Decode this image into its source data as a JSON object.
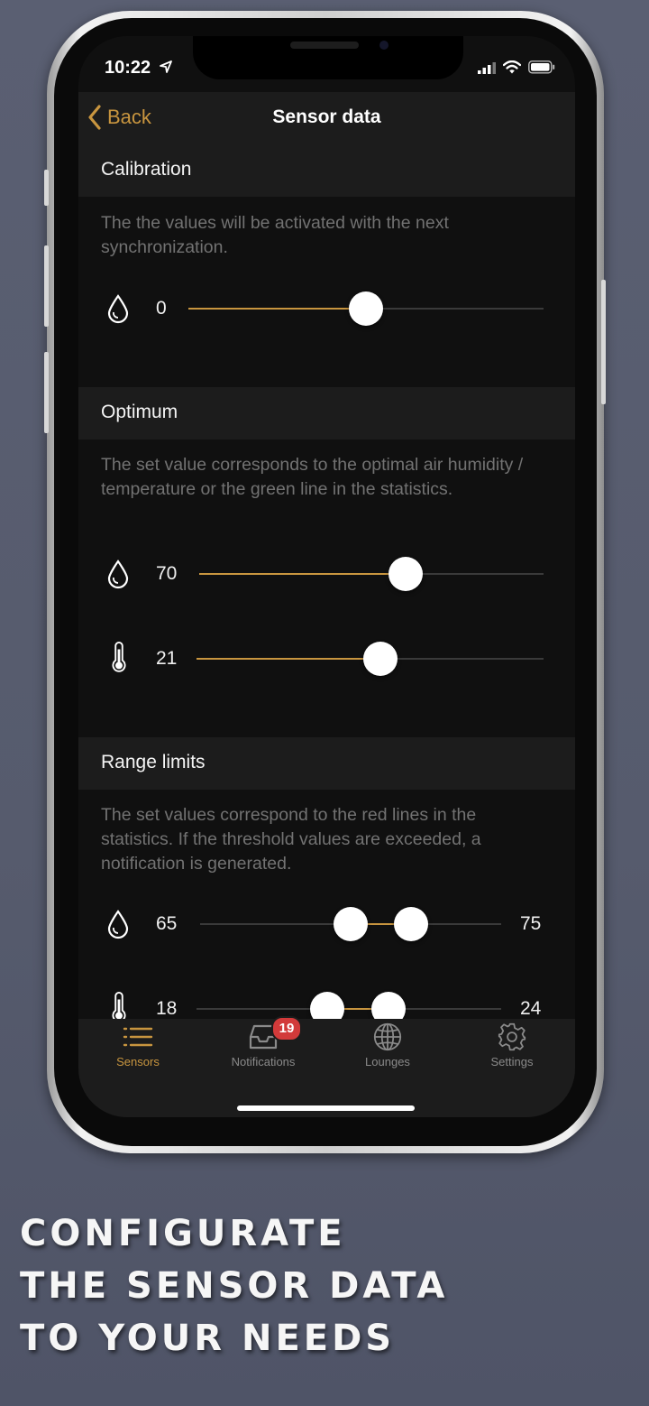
{
  "status_bar": {
    "time": "10:22"
  },
  "nav": {
    "back_label": "Back",
    "title": "Sensor data"
  },
  "sections": {
    "calibration": {
      "title": "Calibration",
      "description": "The the values will be activated with the next synchronization.",
      "humidity": {
        "value": "0",
        "level": 0.5
      }
    },
    "optimum": {
      "title": "Optimum",
      "description": "The set value corresponds to the optimal air humidity / temperature or the green line in the statistics.",
      "humidity": {
        "value": "70",
        "level": 0.6
      },
      "temperature": {
        "value": "21",
        "level": 0.53
      }
    },
    "range_limits": {
      "title": "Range limits",
      "description": "The set values correspond to the red lines in the statistics. If the threshold values are exceeded, a notification is generated.",
      "humidity": {
        "min": "65",
        "max": "75",
        "low_level": 0.5,
        "high_level": 0.7
      },
      "temperature": {
        "min": "18",
        "max": "24",
        "low_level": 0.43,
        "high_level": 0.63
      }
    }
  },
  "tabs": [
    {
      "label": "Sensors",
      "icon": "list-icon",
      "active": true
    },
    {
      "label": "Notifications",
      "icon": "inbox-icon",
      "badge": "19"
    },
    {
      "label": "Lounges",
      "icon": "globe-icon"
    },
    {
      "label": "Settings",
      "icon": "gear-icon"
    }
  ],
  "caption": {
    "line1": "CONFIGURATE",
    "line2": "THE SENSOR DATA",
    "line3": "TO YOUR NEEDS"
  },
  "colors": {
    "accent": "#c8953f",
    "badge": "#d23a3a",
    "background": "#101010",
    "header": "#1c1c1c"
  }
}
